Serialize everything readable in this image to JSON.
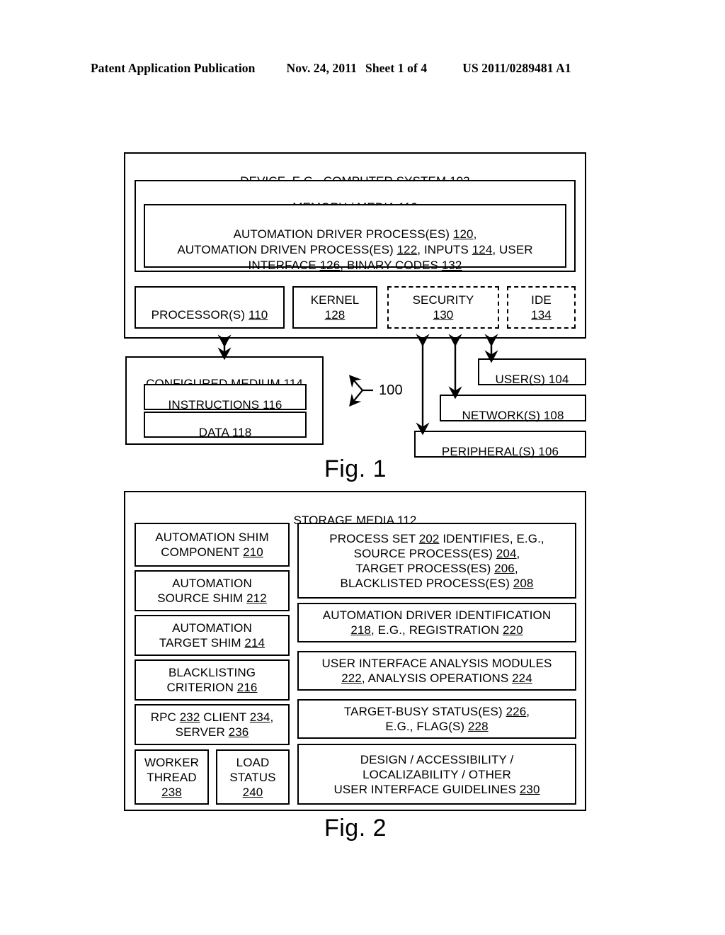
{
  "header": {
    "publication": "Patent Application Publication",
    "date": "Nov. 24, 2011",
    "sheet": "Sheet 1 of 4",
    "number": "US 2011/0289481 A1"
  },
  "figure1": {
    "caption": "Fig. 1",
    "system_label": "100",
    "device_box": "DEVICE, E.G., COMPUTER SYSTEM 102",
    "device_ref": "102",
    "memory_box": "MEMORY / MEDIA 112",
    "memory_ref": "112",
    "processes_box": "AUTOMATION DRIVER PROCESS(ES) 120, AUTOMATION DRIVEN PROCESS(ES) 122, INPUTS 124, USER INTERFACE 126, BINARY CODES 132",
    "processes_line1": "AUTOMATION DRIVER PROCESS(ES) 120,",
    "processes_line2": "AUTOMATION DRIVEN PROCESS(ES) 122, INPUTS 124, USER",
    "processes_line3": "INTERFACE 126, BINARY CODES 132",
    "processor_box": "PROCESSOR(S) 110",
    "kernel_box": "KERNEL 128",
    "security_box": "SECURITY 130",
    "ide_box": "IDE 134",
    "configured_medium_box": "CONFIGURED MEDIUM 114",
    "instructions_box": "INSTRUCTIONS 116",
    "data_box": "DATA 118",
    "users_box": "USER(S) 104",
    "networks_box": "NETWORK(S) 108",
    "peripherals_box": "PERIPHERAL(S) 106"
  },
  "figure2": {
    "caption": "Fig. 2",
    "storage_media_box": "STORAGE MEDIA 112",
    "left_column": [
      {
        "line1": "AUTOMATION SHIM",
        "line2": "COMPONENT 210"
      },
      {
        "line1": "AUTOMATION",
        "line2": "SOURCE SHIM 212"
      },
      {
        "line1": "AUTOMATION",
        "line2": "TARGET SHIM 214"
      },
      {
        "line1": "BLACKLISTING",
        "line2": "CRITERION 216"
      },
      {
        "line1": "RPC 232 CLIENT 234,",
        "line2": "SERVER 236"
      }
    ],
    "worker_thread_box": "WORKER THREAD 238",
    "load_status_box": "LOAD STATUS 240",
    "right_column": [
      {
        "lines": [
          "PROCESS SET 202 IDENTIFIES, E.G.,",
          "SOURCE PROCESS(ES) 204,",
          "TARGET PROCESS(ES) 206,",
          "BLACKLISTED PROCESS(ES) 208"
        ]
      },
      {
        "lines": [
          "AUTOMATION DRIVER IDENTIFICATION",
          "218, E.G., REGISTRATION 220"
        ]
      },
      {
        "lines": [
          "USER INTERFACE ANALYSIS MODULES",
          "222, ANALYSIS OPERATIONS 224"
        ]
      },
      {
        "lines": [
          "TARGET-BUSY STATUS(ES) 226,",
          "E.G., FLAG(S) 228"
        ]
      },
      {
        "lines": [
          "DESIGN / ACCESSIBILITY /",
          "LOCALIZABILITY / OTHER",
          "USER INTERFACE GUIDELINES 230"
        ]
      }
    ]
  }
}
